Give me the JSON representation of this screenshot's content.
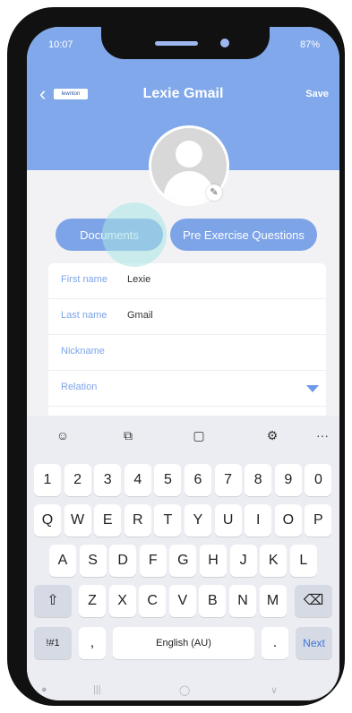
{
  "status": {
    "time": "10:07",
    "battery": "87%"
  },
  "nav": {
    "back_symbol": "‹",
    "logo_text": "lewnton",
    "title": "Lexie Gmail",
    "save_label": "Save"
  },
  "actions": {
    "documents_label": "Documents",
    "pre_exercise_label": "Pre Exercise Questions"
  },
  "form": {
    "first_name_label": "First name",
    "first_name_value": "Lexie",
    "last_name_label": "Last name",
    "last_name_value": "Gmail",
    "nickname_label": "Nickname",
    "relation_label": "Relation"
  },
  "keyboard": {
    "toolbar_icons": [
      "emoji-icon",
      "sticker-icon",
      "clipboard-icon",
      "settings-icon",
      "more-icon"
    ],
    "more_symbol": "···",
    "row_numbers": [
      "1",
      "2",
      "3",
      "4",
      "5",
      "6",
      "7",
      "8",
      "9",
      "0"
    ],
    "row_q": [
      "Q",
      "W",
      "E",
      "R",
      "T",
      "Y",
      "U",
      "I",
      "O",
      "P"
    ],
    "row_a": [
      "A",
      "S",
      "D",
      "F",
      "G",
      "H",
      "J",
      "K",
      "L"
    ],
    "row_z": [
      "Z",
      "X",
      "C",
      "V",
      "B",
      "N",
      "M"
    ],
    "symbols_label": "!#1",
    "comma": ",",
    "space_label": "English (AU)",
    "period": ".",
    "next_label": "Next"
  },
  "colors": {
    "accent": "#80a8ea",
    "button": "#7ea4e8",
    "link_blue": "#3a74d8"
  }
}
